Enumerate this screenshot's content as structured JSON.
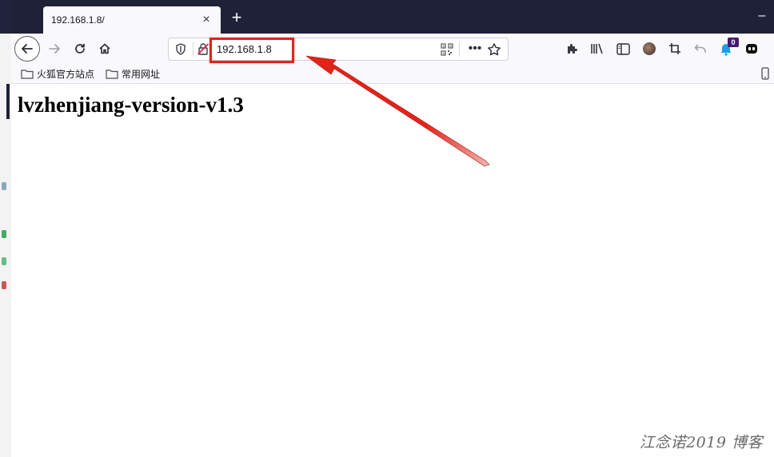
{
  "browser": {
    "tab": {
      "title": "192.168.1.8/",
      "close_glyph": "×"
    },
    "new_tab_glyph": "+",
    "minimize_glyph": "–",
    "url": "192.168.1.8",
    "url_more_glyph": "•••",
    "toolbar_badge": "0"
  },
  "bookmarks": [
    {
      "label": "火狐官方站点"
    },
    {
      "label": "常用网址"
    }
  ],
  "page": {
    "heading": "lvzhenjiang-version-v1.3"
  },
  "watermark": "江念诺2019 博客",
  "colors": {
    "titlebar": "#1f2139",
    "toolbar": "#f9f9fb",
    "annotation_red": "#e2231a"
  },
  "icons": [
    "back-arrow-icon",
    "forward-arrow-icon",
    "reload-icon",
    "home-icon",
    "shield-icon",
    "insecure-lock-icon",
    "qr-code-icon",
    "more-icon",
    "star-icon",
    "extensions-icon",
    "library-icon",
    "sidebar-icon",
    "avatar-icon",
    "crop-icon",
    "undo-icon",
    "notification-icon",
    "ghost-icon",
    "folder-icon",
    "mobile-bookmarks-icon"
  ]
}
